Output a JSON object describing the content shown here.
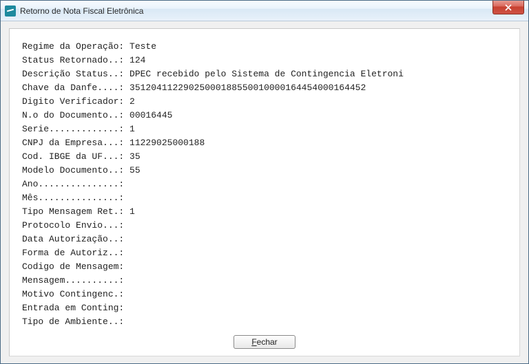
{
  "window": {
    "title": "Retorno de Nota Fiscal Eletrônica"
  },
  "fields": [
    {
      "label": "Regime da Operação: ",
      "value": "Teste"
    },
    {
      "label": "Status Retornado..: ",
      "value": "124"
    },
    {
      "label": "Descrição Status..: ",
      "value": "DPEC recebido pelo Sistema de Contingencia Eletroni"
    },
    {
      "label": "Chave da Danfe....: ",
      "value": "35120411229025000188550010000164454000164452"
    },
    {
      "label": "Digito Verificador: ",
      "value": "2"
    },
    {
      "label": "N.o do Documento..: ",
      "value": "00016445"
    },
    {
      "label": "Serie.............: ",
      "value": "1"
    },
    {
      "label": "CNPJ da Empresa...: ",
      "value": "11229025000188"
    },
    {
      "label": "Cod. IBGE da UF...: ",
      "value": "35"
    },
    {
      "label": "Modelo Documento..: ",
      "value": "55"
    },
    {
      "label": "Ano...............: ",
      "value": ""
    },
    {
      "label": "Mês...............: ",
      "value": ""
    },
    {
      "label": "Tipo Mensagem Ret.: ",
      "value": "1"
    },
    {
      "label": "Protocolo Envio...: ",
      "value": ""
    },
    {
      "label": "Data Autorização..: ",
      "value": ""
    },
    {
      "label": "Forma de Autoriz..: ",
      "value": ""
    },
    {
      "label": "Codigo de Mensagem: ",
      "value": ""
    },
    {
      "label": "Mensagem..........: ",
      "value": ""
    },
    {
      "label": "Motivo Contingenc.: ",
      "value": ""
    },
    {
      "label": "Entrada em Conting: ",
      "value": ""
    },
    {
      "label": "Tipo de Ambiente..: ",
      "value": ""
    }
  ],
  "buttons": {
    "close_label": "Fechar",
    "close_accel_index": 0
  }
}
